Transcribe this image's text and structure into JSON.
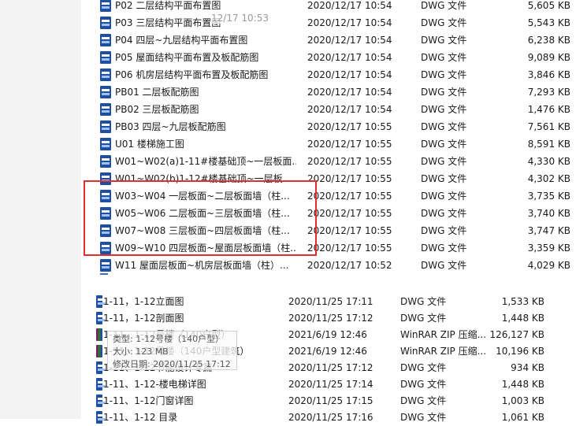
{
  "top_files": [
    {
      "name": "P02 二层结构平面布置图",
      "date": "2020/12/17 10:54",
      "type": "DWG 文件",
      "size": "5,605 KB"
    },
    {
      "name": "P03 三层结构平面布置图",
      "date": "2020/12/17 10:54",
      "type": "DWG 文件",
      "size": "5,543 KB"
    },
    {
      "name": "P04 四层~九层结构平面布置图",
      "date": "2020/12/17 10:54",
      "type": "DWG 文件",
      "size": "6,238 KB"
    },
    {
      "name": "P05 屋面结构平面布置及板配筋图",
      "date": "2020/12/17 10:54",
      "type": "DWG 文件",
      "size": "9,089 KB"
    },
    {
      "name": "P06 机房层结构平面布置及板配筋图",
      "date": "2020/12/17 10:54",
      "type": "DWG 文件",
      "size": "3,846 KB"
    },
    {
      "name": "PB01 二层板配筋图",
      "date": "2020/12/17 10:54",
      "type": "DWG 文件",
      "size": "7,293 KB"
    },
    {
      "name": "PB02 三层板配筋图",
      "date": "2020/12/17 10:54",
      "type": "DWG 文件",
      "size": "1,476 KB"
    },
    {
      "name": "PB03 四层~九层板配筋图",
      "date": "2020/12/17 10:55",
      "type": "DWG 文件",
      "size": "7,561 KB"
    },
    {
      "name": "U01 楼梯施工图",
      "date": "2020/12/17 10:55",
      "type": "DWG 文件",
      "size": "8,591 KB"
    },
    {
      "name": "W01~W02(a)1-11#楼基础顶~一层板面...",
      "date": "2020/12/17 10:55",
      "type": "DWG 文件",
      "size": "4,330 KB"
    },
    {
      "name": "W01~W02(b)1-12#楼基础顶~一层板...",
      "date": "2020/12/17 10:55",
      "type": "DWG 文件",
      "size": "4,302 KB"
    },
    {
      "name": "W03~W04 一层板面~二层板面墙（柱...",
      "date": "2020/12/17 10:55",
      "type": "DWG 文件",
      "size": "3,735 KB"
    },
    {
      "name": "W05~W06 二层板面~三层板面墙（柱...",
      "date": "2020/12/17 10:55",
      "type": "DWG 文件",
      "size": "3,740 KB"
    },
    {
      "name": "W07~W08 三层板面~四层板面墙（柱...",
      "date": "2020/12/17 10:55",
      "type": "DWG 文件",
      "size": "3,747 KB"
    },
    {
      "name": "W09~W10 四层板面~屋面层板面墙（柱...",
      "date": "2020/12/17 10:55",
      "type": "DWG 文件",
      "size": "3,359 KB"
    },
    {
      "name": "W11 屋面层板面~机房层板面墙（柱）...",
      "date": "2020/12/17 10:52",
      "type": "DWG 文件",
      "size": "4,029 KB"
    }
  ],
  "bottom_files": [
    {
      "name": "1-11，1-12立面图",
      "date": "2020/11/25 17:11",
      "type": "DWG 文件",
      "size": "1,533 KB",
      "icon": "dwg"
    },
    {
      "name": "1-11，1-12剖面图",
      "date": "2020/11/25 17:12",
      "type": "DWG 文件",
      "size": "1,448 KB",
      "icon": "dwg"
    },
    {
      "name": "1-11、1-12号楼（140户型）",
      "date": "2021/6/19 12:46",
      "type": "WinRAR ZIP 压缩...",
      "size": "126,127 KB",
      "icon": "zip"
    },
    {
      "name": "1-11、1-12号楼（140户型建筑）",
      "date": "2021/6/19 12:46",
      "type": "WinRAR ZIP 压缩...",
      "size": "10,196 KB",
      "icon": "zip"
    },
    {
      "name": "1-11、1-12节能设计专篇",
      "date": "2020/11/25 17:12",
      "type": "DWG 文件",
      "size": "934 KB",
      "icon": "dwg"
    },
    {
      "name": "1-11、1-12-楼电梯详图",
      "date": "2020/11/25 17:14",
      "type": "DWG 文件",
      "size": "1,448 KB",
      "icon": "dwg"
    },
    {
      "name": "1-11、1-12门窗详图",
      "date": "2020/11/25 17:15",
      "type": "DWG 文件",
      "size": "1,003 KB",
      "icon": "dwg"
    },
    {
      "name": "1-11、1-12 目录",
      "date": "2020/11/25 17:16",
      "type": "DWG 文件",
      "size": "1,061 KB",
      "icon": "dwg"
    }
  ],
  "ghost_text": "12/17 10:53",
  "tooltip": {
    "line1": "类型: 1-12号楼（140户型）",
    "line2": "大小: 123 MB",
    "line3": "修改日期: 2020/11/25 17:12"
  },
  "colors": {
    "highlight": "#e02f2f",
    "dwg_icon": "#1f4fa3"
  }
}
